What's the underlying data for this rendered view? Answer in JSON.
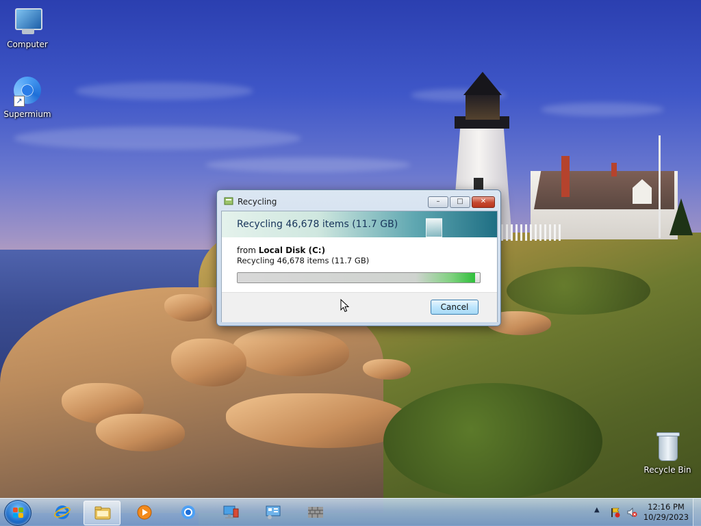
{
  "desktop": {
    "icons": [
      {
        "label": "Computer",
        "icon": "computer-icon"
      },
      {
        "label": "Supermium",
        "icon": "supermium-icon"
      },
      {
        "label": "Recycle Bin",
        "icon": "recycle-bin-icon"
      }
    ]
  },
  "dialog": {
    "title": "Recycling",
    "banner": "Recycling 46,678 items (11.7 GB)",
    "from_prefix": "from ",
    "from_location": "Local Disk (C:)",
    "detail": "Recycling 46,678 items (11.7 GB)",
    "progress_fraction": 0.98,
    "cancel_label": "Cancel",
    "caption_buttons": {
      "minimize": "–",
      "maximize": "□",
      "close": "✕"
    }
  },
  "taskbar": {
    "pinned": [
      {
        "name": "Internet Explorer",
        "icon": "ie-icon"
      },
      {
        "name": "Windows Explorer",
        "icon": "folder-icon",
        "active": true
      },
      {
        "name": "Windows Media Player",
        "icon": "media-player-icon"
      },
      {
        "name": "Supermium",
        "icon": "supermium-icon"
      },
      {
        "name": "Network",
        "icon": "network-icon"
      },
      {
        "name": "Control Panel",
        "icon": "control-panel-icon"
      },
      {
        "name": "Windows Firewall",
        "icon": "firewall-icon"
      }
    ],
    "tray": {
      "show_hidden": "▲",
      "time": "12:16 PM",
      "date": "10/29/2023"
    }
  },
  "colors": {
    "taskbar": "#8fb0d6",
    "close_button": "#c5472f",
    "progress_green": "#2fbf3a",
    "banner_teal": "#1f6f84"
  }
}
